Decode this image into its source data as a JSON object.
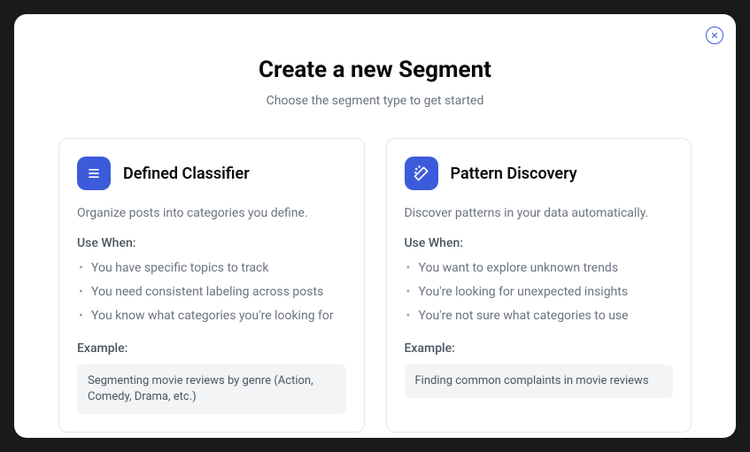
{
  "modal": {
    "title": "Create a new Segment",
    "subtitle": "Choose the segment type to get started"
  },
  "cards": [
    {
      "title": "Defined Classifier",
      "description": "Organize posts into categories you define.",
      "useWhenLabel": "Use When:",
      "useWhen": [
        "You have specific topics to track",
        "You need consistent labeling across posts",
        "You know what categories you're looking for"
      ],
      "exampleLabel": "Example:",
      "example": "Segmenting movie reviews by genre (Action, Comedy, Drama, etc.)"
    },
    {
      "title": "Pattern Discovery",
      "description": "Discover patterns in your data automatically.",
      "useWhenLabel": "Use When:",
      "useWhen": [
        "You want to explore unknown trends",
        "You're looking for unexpected insights",
        "You're not sure what categories to use"
      ],
      "exampleLabel": "Example:",
      "example": "Finding common complaints in movie reviews"
    }
  ]
}
